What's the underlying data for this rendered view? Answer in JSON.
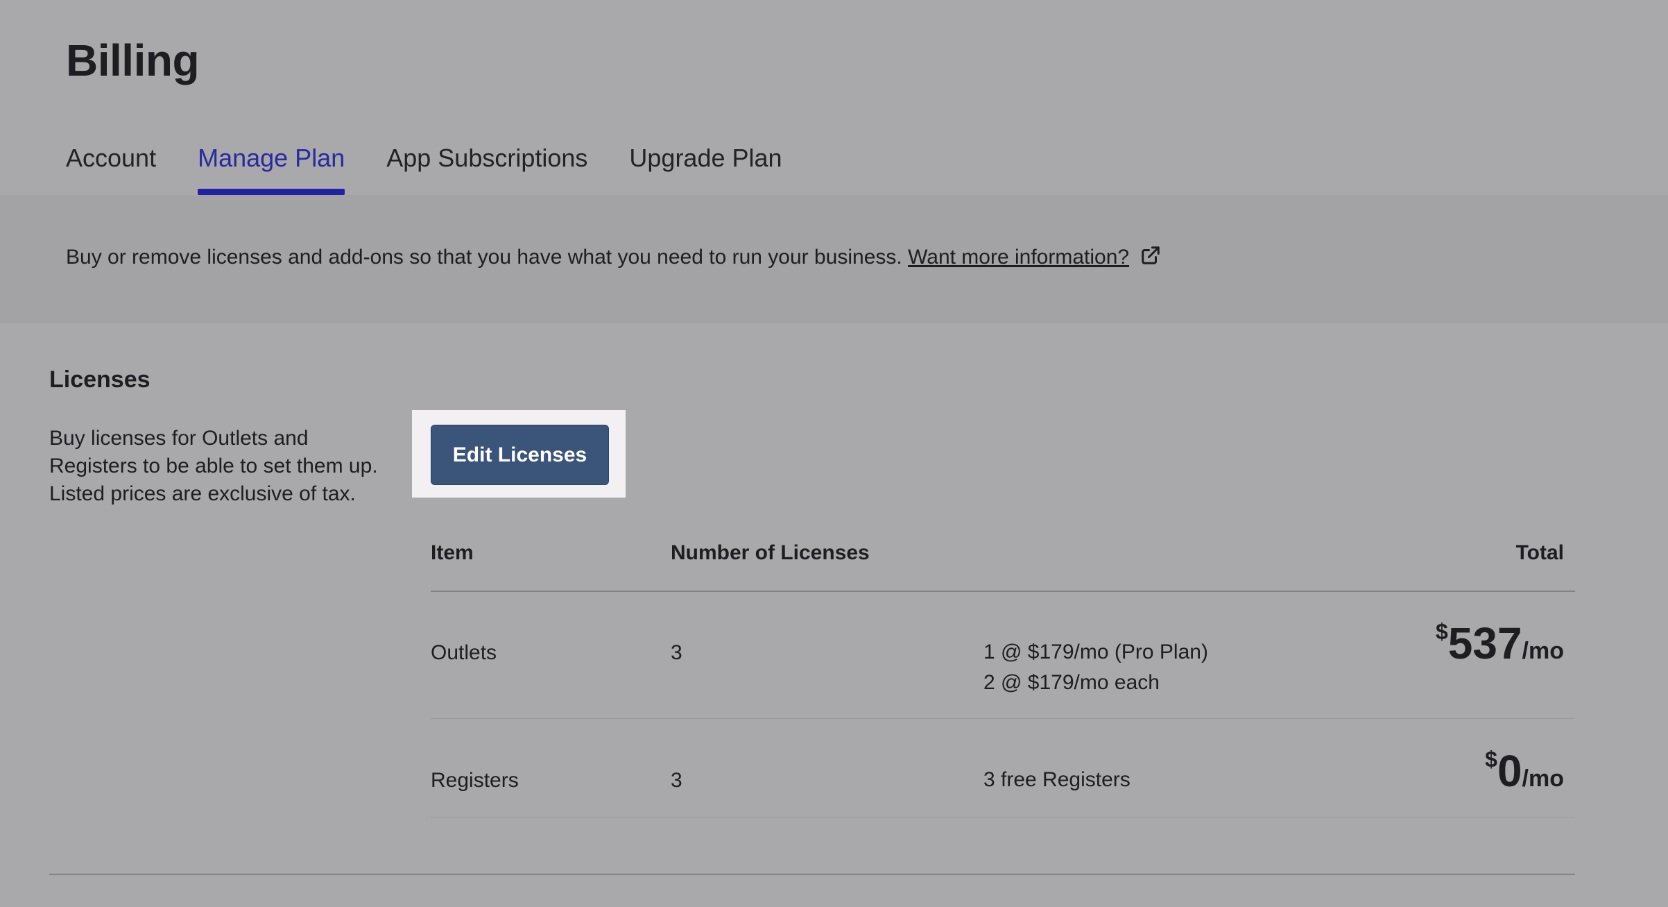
{
  "page": {
    "title": "Billing"
  },
  "tabs": [
    {
      "label": "Account",
      "active": false
    },
    {
      "label": "Manage Plan",
      "active": true
    },
    {
      "label": "App Subscriptions",
      "active": false
    },
    {
      "label": "Upgrade Plan",
      "active": false
    }
  ],
  "info": {
    "text": "Buy or remove licenses and add-ons so that you have what you need to run your business.",
    "link_label": "Want more information?",
    "link_icon": "external-link-icon"
  },
  "licenses": {
    "title": "Licenses",
    "description": "Buy licenses for Outlets and Registers to be able to set them up. Listed prices are exclusive of tax.",
    "edit_button_label": "Edit Licenses",
    "table": {
      "headers": {
        "item": "Item",
        "number": "Number of Licenses",
        "total": "Total"
      },
      "rows": [
        {
          "item": "Outlets",
          "count": "3",
          "details": [
            "1 @ $179/mo (Pro Plan)",
            "2 @ $179/mo each"
          ],
          "currency": "$",
          "amount": "537",
          "period": "/mo"
        },
        {
          "item": "Registers",
          "count": "3",
          "details": [
            "3 free Registers"
          ],
          "currency": "$",
          "amount": "0",
          "period": "/mo"
        }
      ]
    }
  },
  "colors": {
    "background": "#a9a8ab",
    "info_band": "#a3a2a5",
    "active_tab": "#2a2aa0",
    "active_underline": "#2320a6",
    "primary_button": "#3b5479",
    "button_highlight": "#f3f0f4"
  }
}
